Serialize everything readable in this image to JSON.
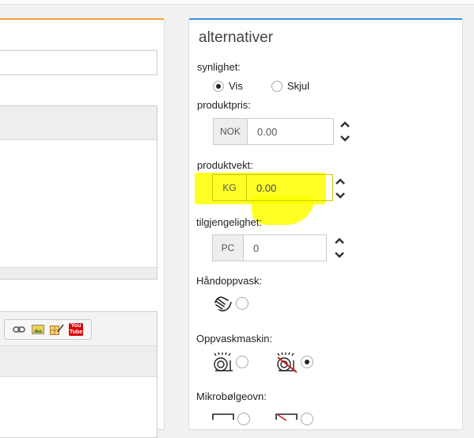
{
  "left": {
    "toolbar": {
      "icons": [
        "link-icon",
        "image-icon",
        "table-edit-icon",
        "youtube-icon"
      ],
      "youtube_top": "You",
      "youtube_bottom": "Tube"
    }
  },
  "options": {
    "title": "alternativer",
    "visibility": {
      "label": "synlighet:",
      "show_label": "Vis",
      "hide_label": "Skjul",
      "selected": "Vis"
    },
    "price": {
      "label": "produktpris:",
      "unit": "NOK",
      "value": "0.00"
    },
    "weight": {
      "label": "produktvekt:",
      "unit": "KG",
      "value": "0.00"
    },
    "stock": {
      "label": "tilgjengelighet:",
      "unit": "PC",
      "value": "0"
    },
    "hand_wash": {
      "label": "Håndoppvask:",
      "icons": [
        "hand-wash-icon"
      ]
    },
    "dishwasher": {
      "label": "Oppvaskmaskin:",
      "icons": [
        "dishwasher-safe-icon",
        "dishwasher-not-safe-icon"
      ],
      "selected": 1
    },
    "microwave": {
      "label": "Mikrobølgeovn:",
      "icons": [
        "microwave-safe-icon",
        "microwave-not-safe-icon"
      ]
    },
    "highlight_color": "#ffff00",
    "accent_left": "#f0a030",
    "accent_right": "#3a8fd6"
  }
}
